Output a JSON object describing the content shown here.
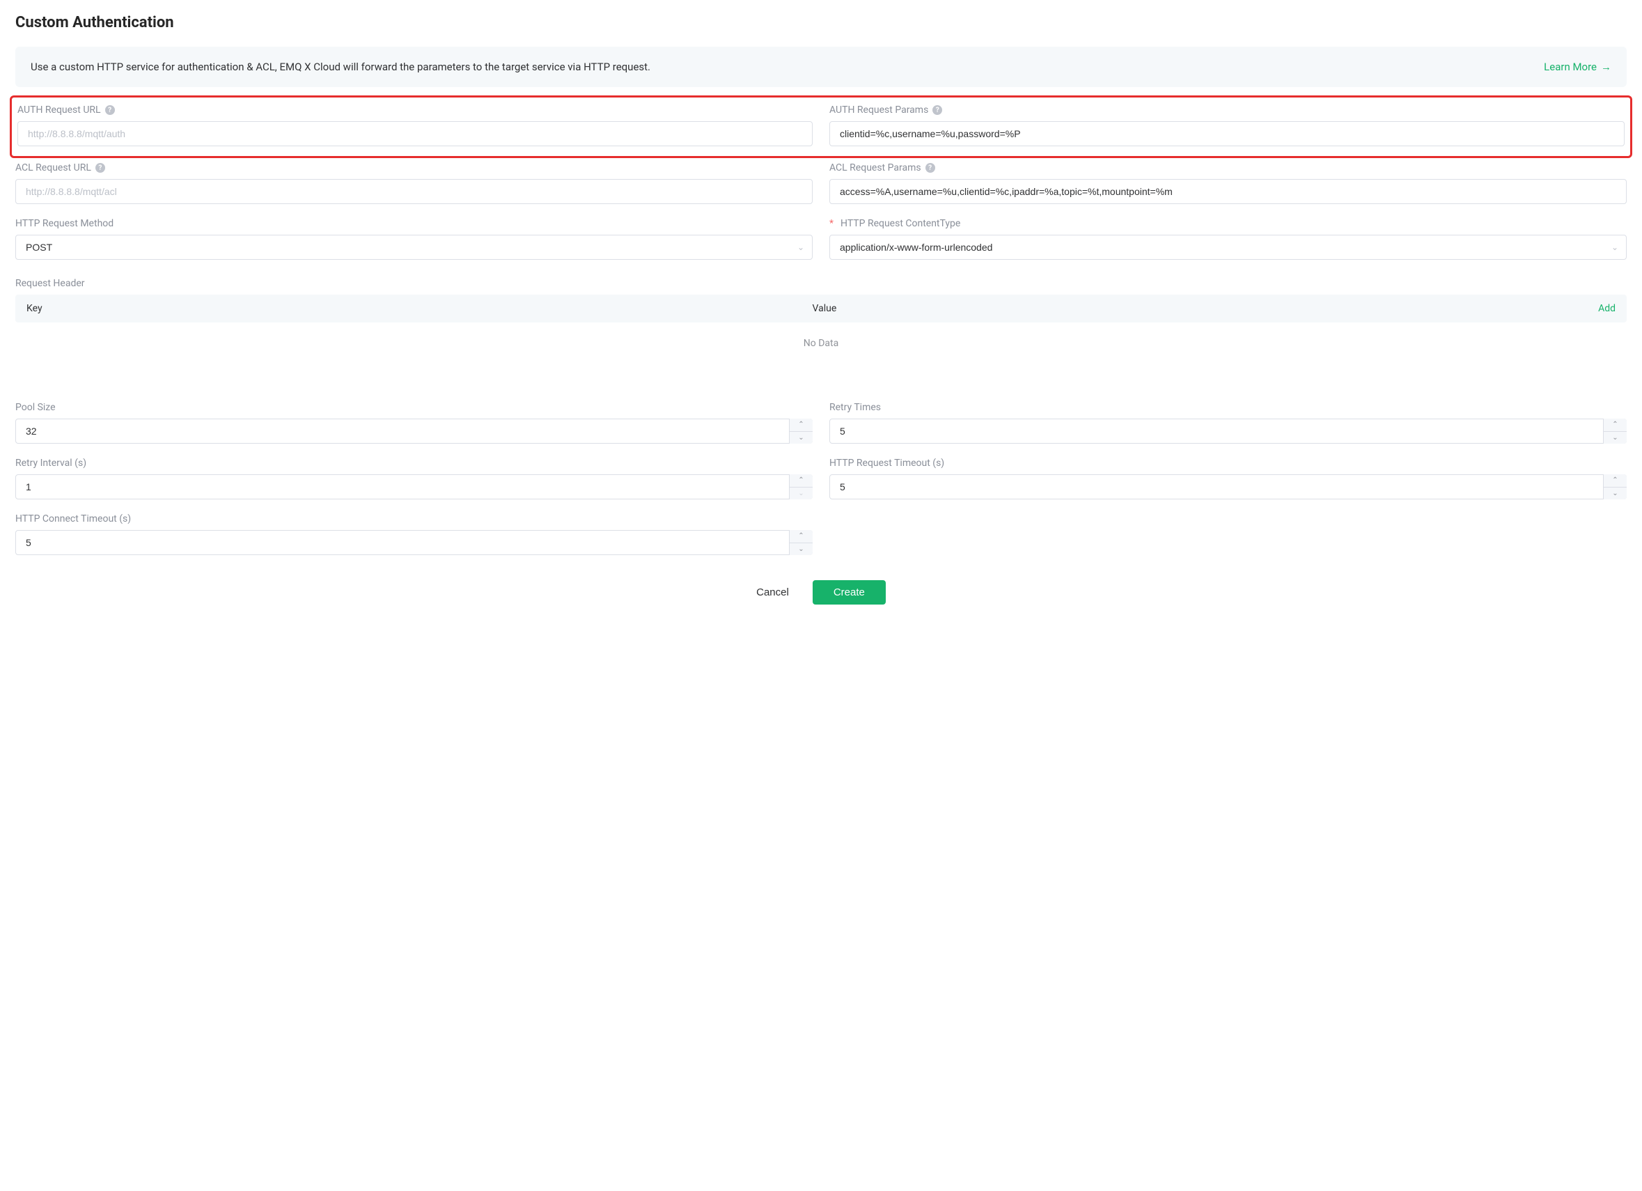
{
  "title": "Custom Authentication",
  "banner": {
    "text": "Use a custom HTTP service for authentication & ACL, EMQ X Cloud will forward the parameters to the target service via HTTP request.",
    "learn_more": "Learn More"
  },
  "fields": {
    "auth_url": {
      "label": "AUTH Request URL",
      "placeholder": "http://8.8.8.8/mqtt/auth",
      "value": ""
    },
    "auth_params": {
      "label": "AUTH Request Params",
      "value": "clientid=%c,username=%u,password=%P"
    },
    "acl_url": {
      "label": "ACL Request URL",
      "placeholder": "http://8.8.8.8/mqtt/acl",
      "value": ""
    },
    "acl_params": {
      "label": "ACL Request Params",
      "value": "access=%A,username=%u,clientid=%c,ipaddr=%a,topic=%t,mountpoint=%m"
    },
    "method": {
      "label": "HTTP Request Method",
      "value": "POST"
    },
    "content_type": {
      "label": "HTTP Request ContentType",
      "value": "application/x-www-form-urlencoded",
      "required": true
    },
    "pool_size": {
      "label": "Pool Size",
      "value": "32"
    },
    "retry_times": {
      "label": "Retry Times",
      "value": "5"
    },
    "retry_interval": {
      "label": "Retry Interval (s)",
      "value": "1"
    },
    "request_timeout": {
      "label": "HTTP Request Timeout (s)",
      "value": "5"
    },
    "connect_timeout": {
      "label": "HTTP Connect Timeout (s)",
      "value": "5"
    }
  },
  "headers": {
    "section_label": "Request Header",
    "col_key": "Key",
    "col_value": "Value",
    "add_label": "Add",
    "no_data": "No Data",
    "rows": []
  },
  "actions": {
    "cancel": "Cancel",
    "create": "Create"
  }
}
